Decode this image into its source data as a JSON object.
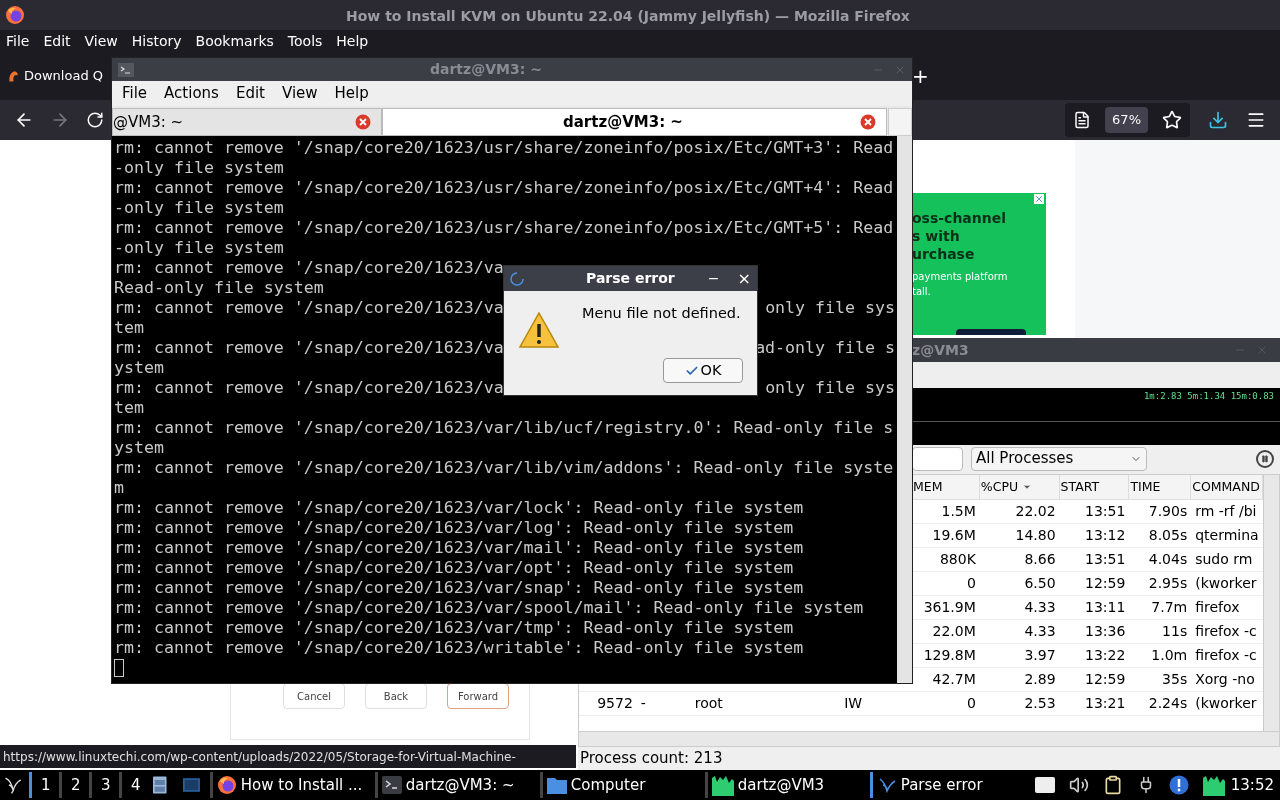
{
  "firefox": {
    "title": "How to Install KVM on Ubuntu 22.04 (Jammy Jellyfish) — Mozilla Firefox",
    "menu": [
      "File",
      "Edit",
      "View",
      "History",
      "Bookmarks",
      "Tools",
      "Help"
    ],
    "tabs": [
      {
        "label": "Download Q",
        "selected": false
      }
    ],
    "new_tab": "+",
    "nav": {
      "back_disabled": false,
      "forward_disabled": true
    },
    "zoom": "67%",
    "page": {
      "ad": {
        "headline": [
          "oss-channel",
          "s with",
          "urchase"
        ],
        "body": [
          "payments platform",
          "tall."
        ]
      },
      "screenshot_buttons": [
        {
          "label": "Cancel",
          "selected": false
        },
        {
          "label": "Back",
          "selected": false
        },
        {
          "label": "Forward",
          "selected": true
        }
      ]
    },
    "status_url": "https://www.linuxtechi.com/wp-content/uploads/2022/05/Storage-for-Virtual-Machine-"
  },
  "process_monitor": {
    "title": "z@VM3",
    "load": "1m:2.83 5m:1.34 15m:0.83",
    "filter": "All Processes",
    "columns": [
      {
        "label": "MEM",
        "sorted": false
      },
      {
        "label": "%CPU",
        "sorted": true
      },
      {
        "label": "START",
        "sorted": false
      },
      {
        "label": "TIME",
        "sorted": false
      },
      {
        "label": "COMMAND",
        "sorted": false
      }
    ],
    "rows": [
      {
        "mem": "1.5M",
        "cpu": "22.02",
        "start": "13:51",
        "time": "7.90s",
        "command": "rm -rf /bi"
      },
      {
        "mem": "19.6M",
        "cpu": "14.80",
        "start": "13:12",
        "time": "8.05s",
        "command": "qtermina"
      },
      {
        "mem": "880K",
        "cpu": "8.66",
        "start": "13:51",
        "time": "4.04s",
        "command": "sudo rm"
      },
      {
        "mem": "0",
        "cpu": "6.50",
        "start": "12:59",
        "time": "2.95s",
        "command": "(kworker"
      },
      {
        "mem": "361.9M",
        "cpu": "4.33",
        "start": "13:11",
        "time": "7.7m",
        "command": "firefox"
      },
      {
        "mem": "22.0M",
        "cpu": "4.33",
        "start": "13:36",
        "time": "11s",
        "command": "firefox -c"
      },
      {
        "mem": "129.8M",
        "cpu": "3.97",
        "start": "13:22",
        "time": "1.0m",
        "command": "firefox -c"
      },
      {
        "mem": "42.7M",
        "cpu": "2.89",
        "start": "12:59",
        "time": "35s",
        "command": "Xorg -no"
      },
      {
        "pid": "9572",
        "nice": "-",
        "user": "root",
        "state": "IW",
        "mem": "0",
        "cpu": "2.53",
        "start": "13:21",
        "time": "2.24s",
        "command": "(kworker"
      }
    ],
    "status": "Process count: 213"
  },
  "terminal": {
    "title": "dartz@VM3: ~",
    "menu": [
      "File",
      "Actions",
      "Edit",
      "View",
      "Help"
    ],
    "tabs": [
      {
        "label": "@VM3: ~",
        "selected": false
      },
      {
        "label": "dartz@VM3: ~",
        "selected": true
      }
    ],
    "lines": [
      {
        "text": "rm: cannot remove '/snap/core20/1623/usr/share/zoneinfo/posix/Etc/GMT+3': Read"
      },
      {
        "text": "-only file system"
      },
      {
        "text": "rm: cannot remove '/snap/core20/1623/usr/share/zoneinfo/posix/Etc/GMT+4': Read"
      },
      {
        "text": "-only file system"
      },
      {
        "text": "rm: cannot remove '/snap/core20/1623/usr/share/zoneinfo/posix/Etc/GMT+5': Read"
      },
      {
        "text": "-only file system"
      },
      {
        "text": "rm: cannot remove '/snap/core20/1623/va"
      },
      {
        "text": "Read-only file system"
      },
      {
        "text": "rm: cannot remove '/snap/core20/1623/va",
        "tail": "only file sys"
      },
      {
        "text": "tem"
      },
      {
        "text": "rm: cannot remove '/snap/core20/1623/va",
        "tail": "ad-only file s"
      },
      {
        "text": "ystem"
      },
      {
        "text": "rm: cannot remove '/snap/core20/1623/va",
        "tail": "only file sys"
      },
      {
        "text": "tem"
      },
      {
        "text": "rm: cannot remove '/snap/core20/1623/var/lib/ucf/registry.0': Read-only file s"
      },
      {
        "text": "ystem"
      },
      {
        "text": "rm: cannot remove '/snap/core20/1623/var/lib/vim/addons': Read-only file syste"
      },
      {
        "text": "m"
      },
      {
        "text": "rm: cannot remove '/snap/core20/1623/var/lock': Read-only file system"
      },
      {
        "text": "rm: cannot remove '/snap/core20/1623/var/log': Read-only file system"
      },
      {
        "text": "rm: cannot remove '/snap/core20/1623/var/mail': Read-only file system"
      },
      {
        "text": "rm: cannot remove '/snap/core20/1623/var/opt': Read-only file system"
      },
      {
        "text": "rm: cannot remove '/snap/core20/1623/var/snap': Read-only file system"
      },
      {
        "text": "rm: cannot remove '/snap/core20/1623/var/spool/mail': Read-only file system"
      },
      {
        "text": "rm: cannot remove '/snap/core20/1623/var/tmp': Read-only file system"
      },
      {
        "text": "rm: cannot remove '/snap/core20/1623/writable': Read-only file system"
      }
    ]
  },
  "dialog": {
    "title": "Parse error",
    "minimize": "−",
    "close": "×",
    "message": "Menu file not defined.",
    "button": "OK"
  },
  "taskbar": {
    "workspaces": [
      {
        "label": "1",
        "selected": true
      },
      {
        "label": "2",
        "selected": false
      },
      {
        "label": "3",
        "selected": false
      },
      {
        "label": "4",
        "selected": false
      }
    ],
    "tasks": [
      {
        "kind": "firefox",
        "label": "How to Install ...",
        "selected": false
      },
      {
        "kind": "terminal",
        "label": "dartz@VM3: ~",
        "selected": false
      },
      {
        "kind": "folder",
        "label": "Computer",
        "selected": false
      },
      {
        "kind": "monitor",
        "label": "dartz@VM3",
        "selected": false
      },
      {
        "kind": "dialog",
        "label": "Parse error",
        "selected": true
      }
    ],
    "clock": "13:52"
  }
}
